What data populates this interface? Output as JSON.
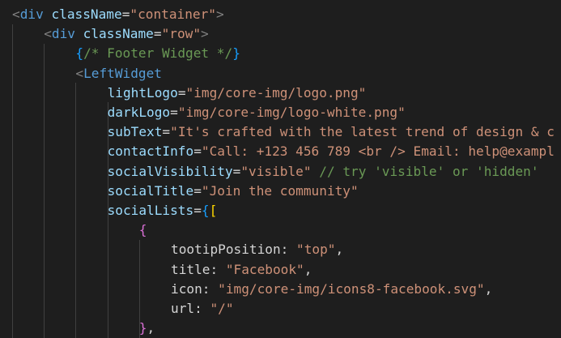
{
  "colors": {
    "background": "#1e1e1e",
    "guide": "#404040",
    "tag": "#569cd6",
    "attribute": "#9cdcfe",
    "string": "#ce9178",
    "comment": "#6a9955",
    "punctuation": "#d4d4d4",
    "angle": "#808080",
    "bracket_level1": "#ffd700",
    "bracket_level2": "#da70d6",
    "bracket_level3": "#179fff"
  },
  "code_lines": [
    [
      {
        "t": "<",
        "c": "ang"
      },
      {
        "t": "div",
        "c": "tag"
      },
      {
        "t": " ",
        "c": "plain"
      },
      {
        "t": "className",
        "c": "attr"
      },
      {
        "t": "=",
        "c": "plain"
      },
      {
        "t": "\"container\"",
        "c": "str"
      },
      {
        "t": ">",
        "c": "ang"
      }
    ],
    [
      {
        "t": "<",
        "c": "ang"
      },
      {
        "t": "div",
        "c": "tag"
      },
      {
        "t": " ",
        "c": "plain"
      },
      {
        "t": "className",
        "c": "attr"
      },
      {
        "t": "=",
        "c": "plain"
      },
      {
        "t": "\"row\"",
        "c": "str"
      },
      {
        "t": ">",
        "c": "ang"
      }
    ],
    [
      {
        "t": "{",
        "c": "brace2"
      },
      {
        "t": "/* Footer Widget */",
        "c": "cmt"
      },
      {
        "t": "}",
        "c": "brace2"
      }
    ],
    [
      {
        "t": "<",
        "c": "ang"
      },
      {
        "t": "LeftWidget",
        "c": "tag"
      }
    ],
    [
      {
        "t": "lightLogo",
        "c": "attr"
      },
      {
        "t": "=",
        "c": "plain"
      },
      {
        "t": "\"img/core-img/logo.png\"",
        "c": "str"
      }
    ],
    [
      {
        "t": "darkLogo",
        "c": "attr"
      },
      {
        "t": "=",
        "c": "plain"
      },
      {
        "t": "\"img/core-img/logo-white.png\"",
        "c": "str"
      }
    ],
    [
      {
        "t": "subText",
        "c": "attr"
      },
      {
        "t": "=",
        "c": "plain"
      },
      {
        "t": "\"It's crafted with the latest trend of design & c",
        "c": "str"
      }
    ],
    [
      {
        "t": "contactInfo",
        "c": "attr"
      },
      {
        "t": "=",
        "c": "plain"
      },
      {
        "t": "\"Call: +123 456 789 <br /> Email: help@exampl",
        "c": "str"
      }
    ],
    [
      {
        "t": "socialVisibility",
        "c": "attr"
      },
      {
        "t": "=",
        "c": "plain"
      },
      {
        "t": "\"visible\"",
        "c": "str"
      },
      {
        "t": " ",
        "c": "plain"
      },
      {
        "t": "// try 'visible' or 'hidden'",
        "c": "cmt"
      }
    ],
    [
      {
        "t": "socialTitle",
        "c": "attr"
      },
      {
        "t": "=",
        "c": "plain"
      },
      {
        "t": "\"Join the community\"",
        "c": "str"
      }
    ],
    [
      {
        "t": "socialLists",
        "c": "attr"
      },
      {
        "t": "=",
        "c": "plain"
      },
      {
        "t": "{",
        "c": "brace2"
      },
      {
        "t": "[",
        "c": "brace3"
      }
    ],
    [
      {
        "t": "{",
        "c": "brace"
      }
    ],
    [
      {
        "t": "tootipPosition",
        "c": "plain"
      },
      {
        "t": ": ",
        "c": "plain"
      },
      {
        "t": "\"top\"",
        "c": "str"
      },
      {
        "t": ",",
        "c": "plain"
      }
    ],
    [
      {
        "t": "title",
        "c": "plain"
      },
      {
        "t": ": ",
        "c": "plain"
      },
      {
        "t": "\"Facebook\"",
        "c": "str"
      },
      {
        "t": ",",
        "c": "plain"
      }
    ],
    [
      {
        "t": "icon",
        "c": "plain"
      },
      {
        "t": ": ",
        "c": "plain"
      },
      {
        "t": "\"img/core-img/icons8-facebook.svg\"",
        "c": "str"
      },
      {
        "t": ",",
        "c": "plain"
      }
    ],
    [
      {
        "t": "url",
        "c": "plain"
      },
      {
        "t": ": ",
        "c": "plain"
      },
      {
        "t": "\"/\"",
        "c": "str"
      }
    ],
    [
      {
        "t": "}",
        "c": "brace"
      },
      {
        "t": ",",
        "c": "plain"
      }
    ]
  ]
}
